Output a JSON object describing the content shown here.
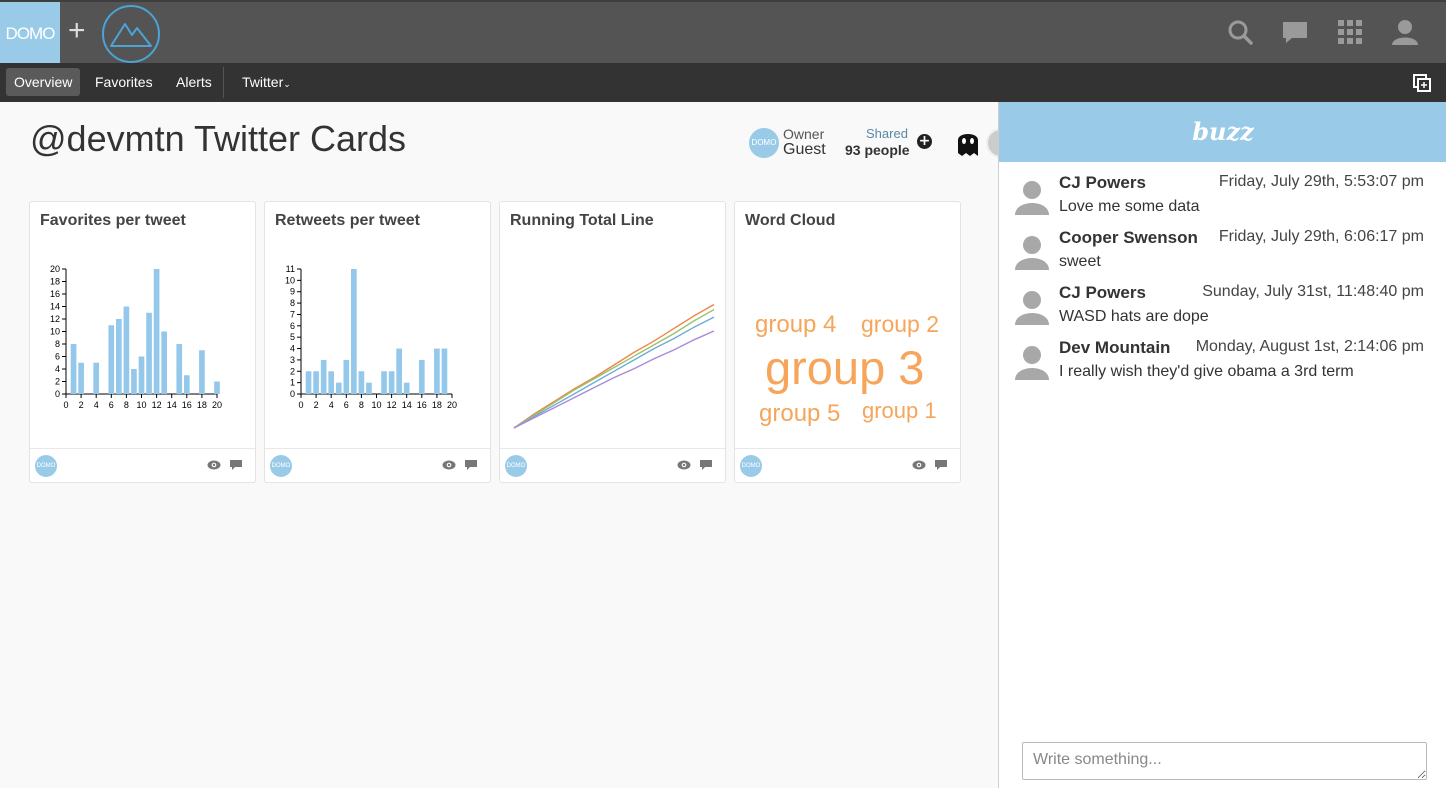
{
  "header": {
    "logo_text": "DOMO",
    "plus": "+",
    "icons": [
      "search-icon",
      "chat-icon",
      "apps-grid-icon",
      "user-icon"
    ]
  },
  "nav": {
    "items": [
      {
        "label": "Overview",
        "active": true
      },
      {
        "label": "Favorites"
      },
      {
        "label": "Alerts"
      },
      {
        "label": "Twitter"
      }
    ],
    "right_icon": "copy-window-icon"
  },
  "page": {
    "title": "@devmtn Twitter Cards",
    "owner_label": "Owner",
    "owner_name": "Guest",
    "owner_avatar_text": "DOMO",
    "shared_label": "Shared",
    "shared_count": "93 people",
    "add_share": "+"
  },
  "cards": [
    {
      "title": "Favorites per tweet",
      "badge": "DOMO"
    },
    {
      "title": "Retweets per tweet",
      "badge": "DOMO"
    },
    {
      "title": "Running Total Line",
      "badge": "DOMO"
    },
    {
      "title": "Word Cloud",
      "badge": "DOMO"
    }
  ],
  "word_cloud": {
    "words": [
      "group 4",
      "group 2",
      "group 3",
      "group 5",
      "group 1"
    ],
    "color": "#f6a55a"
  },
  "chart_data": [
    {
      "type": "bar",
      "title": "Favorites per tweet",
      "x": [
        1,
        2,
        4,
        6,
        7,
        8,
        9,
        10,
        11,
        12,
        13,
        15,
        16,
        18,
        20
      ],
      "values": [
        8,
        5,
        5,
        11,
        12,
        14,
        4,
        6,
        13,
        20,
        10,
        8,
        3,
        7,
        2
      ],
      "xlim": [
        0,
        20
      ],
      "ylim": [
        0,
        20
      ],
      "xticks": [
        0,
        2,
        4,
        6,
        8,
        10,
        12,
        14,
        16,
        18,
        20
      ],
      "yticks": [
        0,
        2,
        4,
        6,
        8,
        10,
        12,
        14,
        16,
        18,
        20
      ],
      "color": "#94c8ea"
    },
    {
      "type": "bar",
      "title": "Retweets per tweet",
      "x": [
        1,
        2,
        3,
        4,
        5,
        6,
        7,
        8,
        9,
        11,
        12,
        13,
        14,
        16,
        18,
        19
      ],
      "values": [
        2,
        2,
        3,
        2,
        1,
        3,
        11,
        2,
        1,
        2,
        2,
        4,
        1,
        3,
        4,
        4
      ],
      "xlim": [
        0,
        20
      ],
      "ylim": [
        0,
        11
      ],
      "xticks": [
        0,
        2,
        4,
        6,
        8,
        10,
        12,
        14,
        16,
        18,
        20
      ],
      "yticks": [
        0,
        1,
        2,
        3,
        4,
        5,
        6,
        7,
        8,
        9,
        10,
        11
      ],
      "color": "#94c8ea"
    },
    {
      "type": "line",
      "title": "Running Total Line",
      "x": [
        0,
        1,
        2,
        3,
        4,
        5,
        6,
        7,
        8,
        9,
        10
      ],
      "series": [
        {
          "color": "#f0854a",
          "values": [
            0,
            11,
            21,
            31,
            40,
            50,
            60,
            69,
            79,
            89,
            98
          ]
        },
        {
          "color": "#9bc26a",
          "values": [
            0,
            10,
            20,
            30,
            39,
            48,
            57,
            66,
            75,
            85,
            94
          ]
        },
        {
          "color": "#6aaed6",
          "values": [
            0,
            9,
            18,
            27,
            36,
            45,
            54,
            63,
            71,
            80,
            88
          ]
        },
        {
          "color": "#a98ad9",
          "values": [
            0,
            8,
            16,
            24,
            32,
            40,
            47,
            55,
            62,
            70,
            77
          ]
        }
      ],
      "ylim": [
        0,
        100
      ]
    }
  ],
  "buzz": {
    "title": "buzz",
    "messages": [
      {
        "name": "CJ Powers",
        "time": "Friday, July 29th, 5:53:07 pm",
        "text": "Love me some data"
      },
      {
        "name": "Cooper Swenson",
        "time": "Friday, July 29th, 6:06:17 pm",
        "text": "sweet"
      },
      {
        "name": "CJ Powers",
        "time": "Sunday, July 31st, 11:48:40 pm",
        "text": "WASD hats are dope"
      },
      {
        "name": "Dev Mountain",
        "time": "Monday, August 1st, 2:14:06 pm",
        "text": "I really wish they'd give obama a 3rd term"
      }
    ],
    "input_placeholder": "Write something..."
  }
}
